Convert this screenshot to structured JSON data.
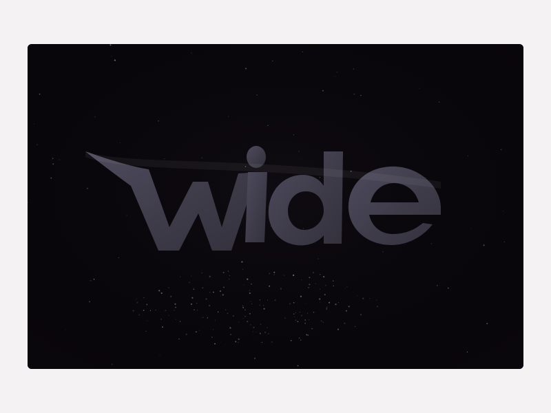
{
  "logo": {
    "text": "wide",
    "letter_color": "#3f3c4a",
    "letter_highlight": "#55526a",
    "background_color": "#0a070c"
  },
  "page": {
    "background_color": "#f4f2f3"
  }
}
